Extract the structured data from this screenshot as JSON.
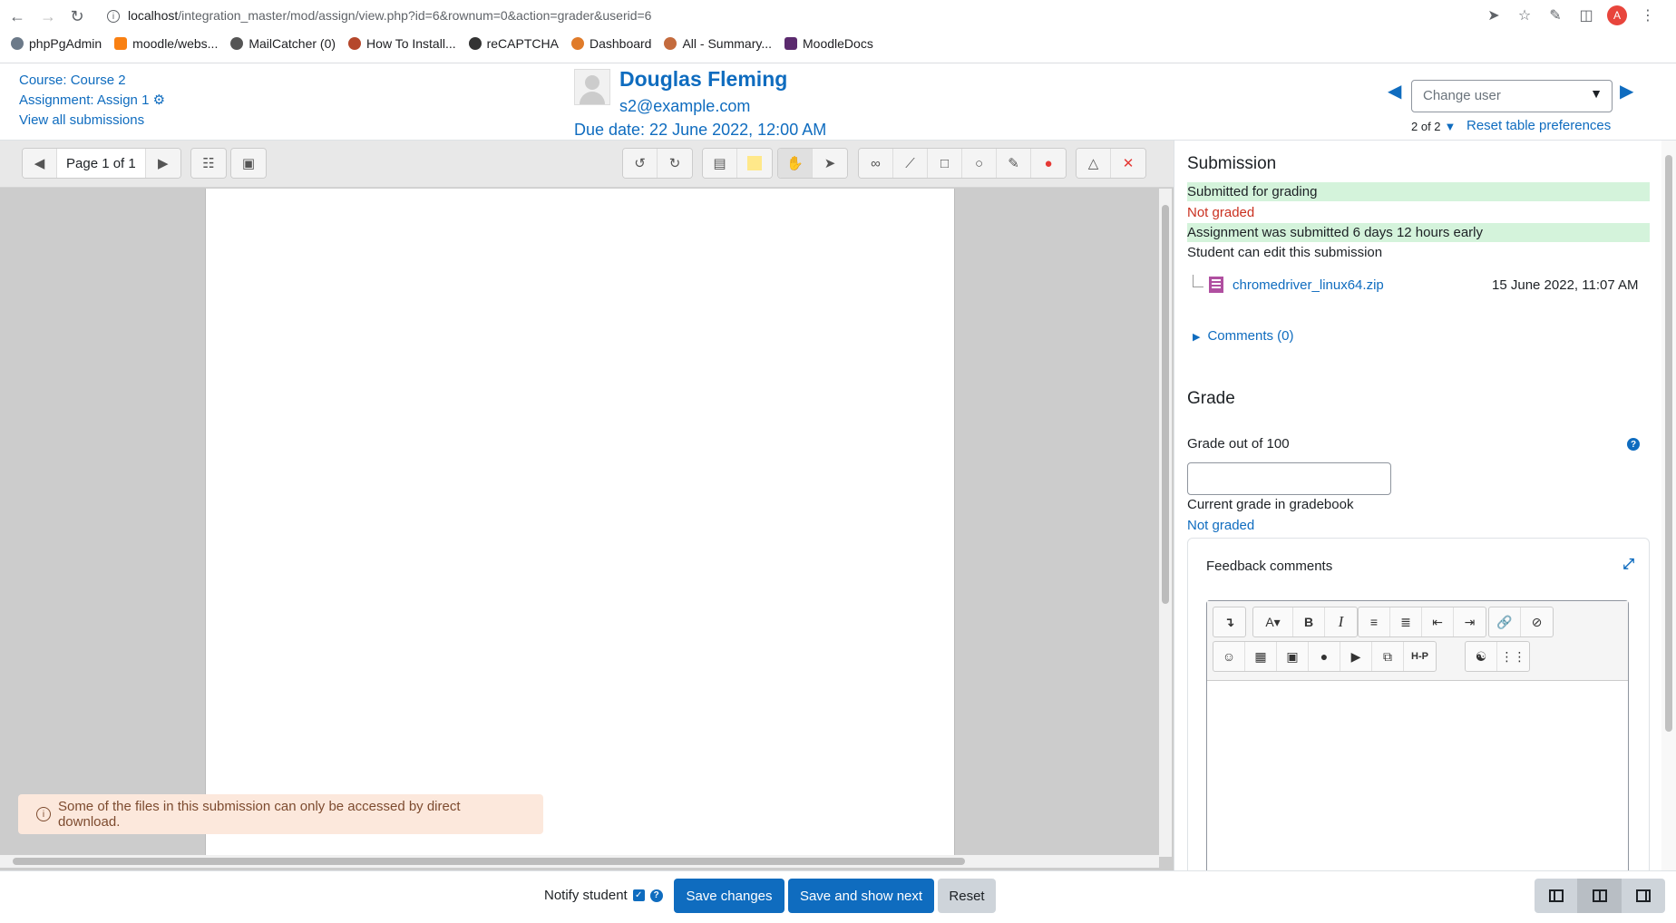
{
  "browser": {
    "url_host": "localhost",
    "url_path": "/integration_master/mod/assign/view.php?id=6&rownum=0&action=grader&userid=6",
    "profile_initial": "A",
    "bookmarks": [
      {
        "label": "phpPgAdmin",
        "color": "#6c7a89"
      },
      {
        "label": "moodle/webs...",
        "color": "#f98012"
      },
      {
        "label": "MailCatcher (0)",
        "color": "#555555"
      },
      {
        "label": "How To Install...",
        "color": "#b5472b"
      },
      {
        "label": "reCAPTCHA",
        "color": "#333333"
      },
      {
        "label": "Dashboard",
        "color": "#e07b2a"
      },
      {
        "label": "All - Summary...",
        "color": "#c46b3d"
      },
      {
        "label": "MoodleDocs",
        "color": "#5b2a6e"
      }
    ]
  },
  "header": {
    "course_link": "Course: Course 2",
    "assignment_link": "Assignment: Assign 1",
    "view_all": "View all submissions",
    "user_name": "Douglas Fleming",
    "user_email": "s2@example.com",
    "due_date": "Due date: 22 June 2022, 12:00 AM",
    "change_user_placeholder": "Change user",
    "count": "2 of 2",
    "reset_prefs": "Reset table preferences"
  },
  "toolbar": {
    "page_label": "Page 1 of 1"
  },
  "notice": {
    "text": "Some of the files in this submission can only be accessed by direct download."
  },
  "submission": {
    "title": "Submission",
    "status": "Submitted for grading",
    "grading_status": "Not graded",
    "timing": "Assignment was submitted 6 days 12 hours early",
    "edit_status": "Student can edit this submission",
    "file_name": "chromedriver_linux64.zip",
    "file_date": "15 June 2022, 11:07 AM",
    "comments": "Comments (0)"
  },
  "grade": {
    "title": "Grade",
    "label": "Grade out of 100",
    "value": "",
    "current_label": "Current grade in gradebook",
    "current_value": "Not graded",
    "feedback_title": "Feedback comments"
  },
  "footer": {
    "notify_label": "Notify student",
    "notify_checked": true,
    "save": "Save changes",
    "save_next": "Save and show next",
    "reset": "Reset"
  }
}
